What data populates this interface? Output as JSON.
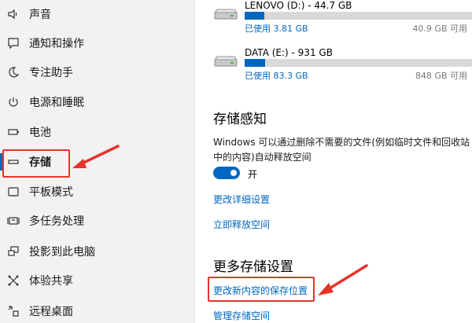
{
  "sidebar": {
    "items": [
      {
        "label": "声音",
        "icon": "speaker-icon"
      },
      {
        "label": "通知和操作",
        "icon": "message-icon"
      },
      {
        "label": "专注助手",
        "icon": "moon-icon"
      },
      {
        "label": "电源和睡眠",
        "icon": "power-icon"
      },
      {
        "label": "电池",
        "icon": "battery-icon"
      },
      {
        "label": "存储",
        "icon": "storage-icon"
      },
      {
        "label": "平板模式",
        "icon": "tablet-icon"
      },
      {
        "label": "多任务处理",
        "icon": "multitask-icon"
      },
      {
        "label": "投影到此电脑",
        "icon": "projection-icon"
      },
      {
        "label": "体验共享",
        "icon": "share-icon"
      },
      {
        "label": "远程桌面",
        "icon": "remote-icon"
      }
    ],
    "active_item": "存储"
  },
  "drives": [
    {
      "name": "LENOVO (D:) - 44.7 GB",
      "used": "已使用 3.81 GB",
      "free": "40.9 GB 可用",
      "used_fraction": 0.085
    },
    {
      "name": "DATA (E:) - 931 GB",
      "used": "已使用 83.3 GB",
      "free": "848 GB 可用",
      "used_fraction": 0.09
    }
  ],
  "storage_sense": {
    "title": "存储感知",
    "description": "Windows 可以通过删除不需要的文件(例如临时文件和回收站中的内容)自动释放空间",
    "toggle_state": "开",
    "toggle_on": true,
    "link_details": "更改详细设置",
    "link_free_now": "立即释放空间"
  },
  "more_storage": {
    "title": "更多存储设置",
    "link_save_location": "更改新内容的保存位置",
    "link_manage_spaces": "管理存储空间"
  },
  "colors": {
    "accent": "#0067c0",
    "annotation": "#e8332a",
    "sidebar_bg": "#f2f2f2"
  }
}
